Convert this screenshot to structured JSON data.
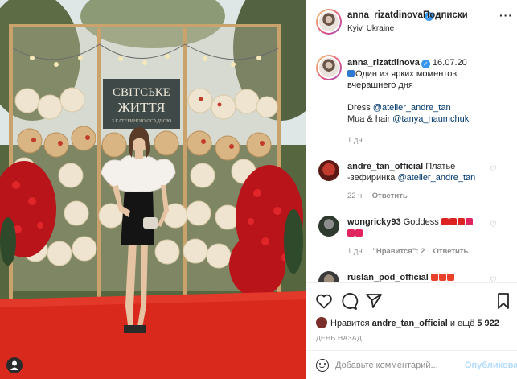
{
  "post": {
    "username": "anna_rizatdinova",
    "follow_label": "Подписки",
    "location": "Kyiv, Ukraine",
    "sign_text": [
      "СВІТСЬКЕ",
      "ЖИТТЯ",
      "З КАТЕРИНОЮ ОСАДЧОЮ"
    ]
  },
  "caption": {
    "username": "anna_rizatdinova",
    "date": "16.07.20",
    "line1": "Один из ярких моментов",
    "line2": "вчерашнего дня",
    "dress_label": "Dress",
    "dress_tag": "@atelier_andre_tan",
    "mua_label": "Mua & hair",
    "mua_tag": "@tanya_naumchuk",
    "age": "1 дн."
  },
  "comments": [
    {
      "username": "andre_tan_official",
      "text": "Платье -зефиринка",
      "tag": "@atelier_andre_tan",
      "age": "22 ч.",
      "reply": "Ответить"
    },
    {
      "username": "wongricky93",
      "text": "Goddess",
      "age": "1 дн.",
      "likes": "\"Нравится\": 2",
      "reply": "Ответить"
    },
    {
      "username": "ruslan_pod_official"
    }
  ],
  "likes": {
    "prefix": "Нравится",
    "user": "andre_tan_official",
    "middle": "и ещё",
    "count": "5 922"
  },
  "date_label": "ДЕНЬ НАЗАД",
  "comment_box": {
    "placeholder": "Добавьте комментарий...",
    "post_label": "Опубликовать"
  },
  "icons": {
    "more": "more-options-icon",
    "like": "heart-icon",
    "comment": "comment-bubble-icon",
    "share": "paper-plane-icon",
    "save": "bookmark-icon"
  },
  "colors": {
    "accent_link": "#00376b",
    "verified": "#3897f0",
    "post_button_disabled": "#b3dbff",
    "carpet": "#d9291c"
  }
}
